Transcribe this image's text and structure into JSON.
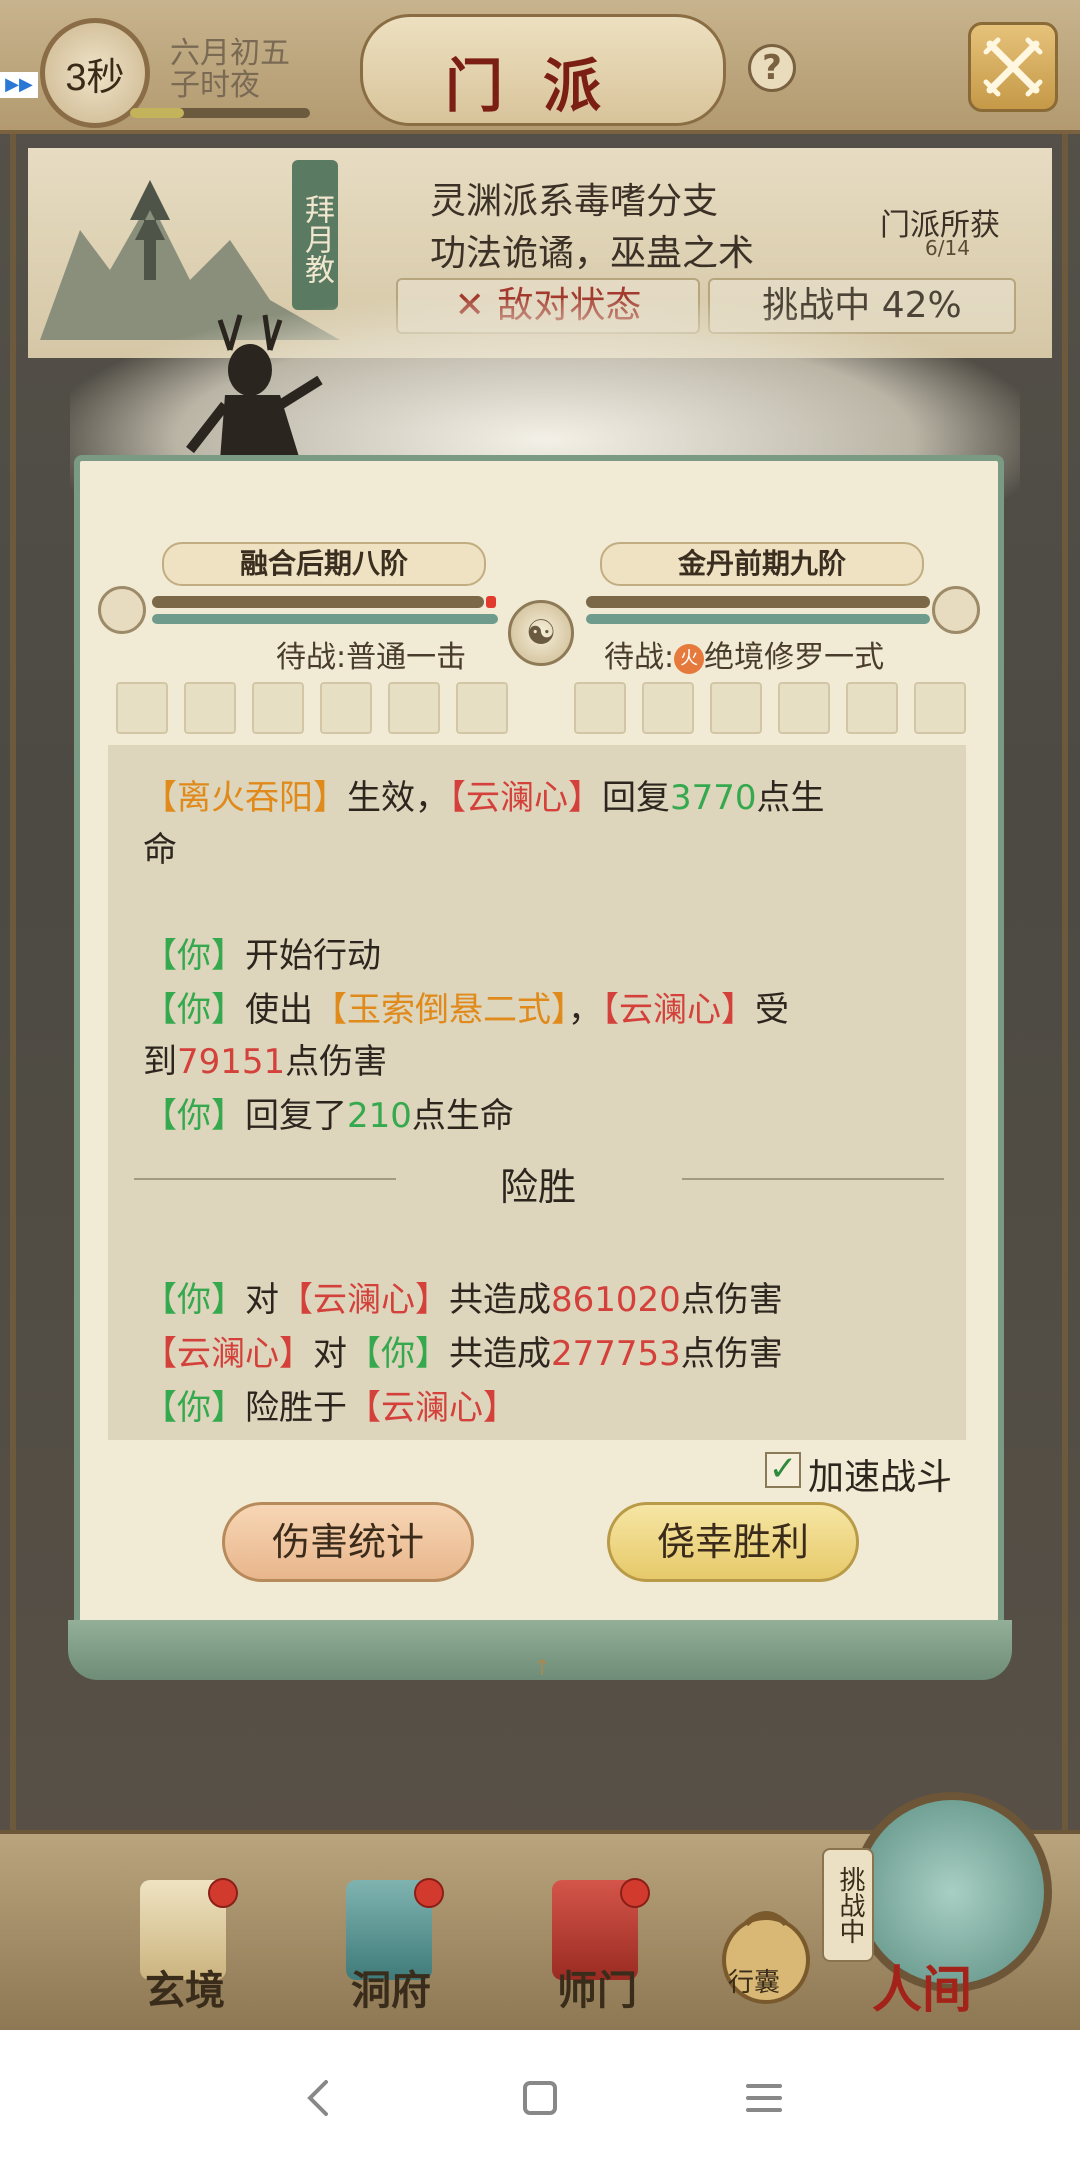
{
  "header": {
    "timer": "3秒",
    "date_line1": "六月初五",
    "date_line2": "子时夜",
    "title": "门派",
    "help_symbol": "?",
    "close_icon": "crossed-swords-icon",
    "speed_indicator": "▶▶"
  },
  "sect": {
    "badge": "拜月教",
    "desc_line1": "灵渊派系毒嗜分支",
    "desc_line2": "功法诡谲，巫蛊之术",
    "reward_label": "门派所获",
    "reward_count": "6/14",
    "status": "敌对状态",
    "challenge_progress": "挑战中 42%"
  },
  "battle": {
    "left_rank": "融合后期八阶",
    "right_rank": "金丹前期九阶",
    "left_stance": "待战:普通一击",
    "right_stance_prefix": "待战:",
    "right_stance_element": "火",
    "right_stance_skill": "绝境修罗一式",
    "left_hp": 0.96,
    "right_hp": 1.0,
    "log": {
      "l1_a": "【离火吞阳】",
      "l1_b": "生效，",
      "l1_c": "【云澜心】",
      "l1_d": "回复",
      "l1_e": "3770",
      "l1_f": "点生",
      "l2_a": "命",
      "l3_a": "【你】",
      "l3_b": "开始行动",
      "l4_a": "【你】",
      "l4_b": "使出",
      "l4_c": "【玉索倒悬二式】",
      "l4_d": "，",
      "l4_e": "【云澜心】",
      "l4_f": "受",
      "l5_a": "到",
      "l5_b": "79151",
      "l5_c": "点伤害",
      "l6_a": "【你】",
      "l6_b": "回复了",
      "l6_c": "210",
      "l6_d": "点生命",
      "divider": "险胜",
      "l7_a": "【你】",
      "l7_b": "对",
      "l7_c": "【云澜心】",
      "l7_d": "共造成",
      "l7_e": "861020",
      "l7_f": "点伤害",
      "l8_a": "【云澜心】",
      "l8_b": "对",
      "l8_c": "【你】",
      "l8_d": "共造成",
      "l8_e": "277753",
      "l8_f": "点伤害",
      "l9_a": "【你】",
      "l9_b": "险胜于",
      "l9_c": "【云澜心】"
    },
    "speed_label": "加速战斗",
    "speed_checked": true,
    "damage_stats_button": "伤害统计",
    "win_button": "侥幸胜利"
  },
  "nav": {
    "items": [
      {
        "label": "玄境",
        "icon": "scroll-icon",
        "badge": true
      },
      {
        "label": "洞府",
        "icon": "lantern-icon",
        "badge": true
      },
      {
        "label": "师门",
        "icon": "banner-icon",
        "badge": true
      }
    ],
    "bag_label": "行囊",
    "world_tag": "挑战中",
    "world_label": "人间"
  },
  "colors": {
    "skill_orange": "#e08a1c",
    "name_red": "#d4413b",
    "value_green": "#36a94e",
    "frame_green": "#7a9a84"
  }
}
